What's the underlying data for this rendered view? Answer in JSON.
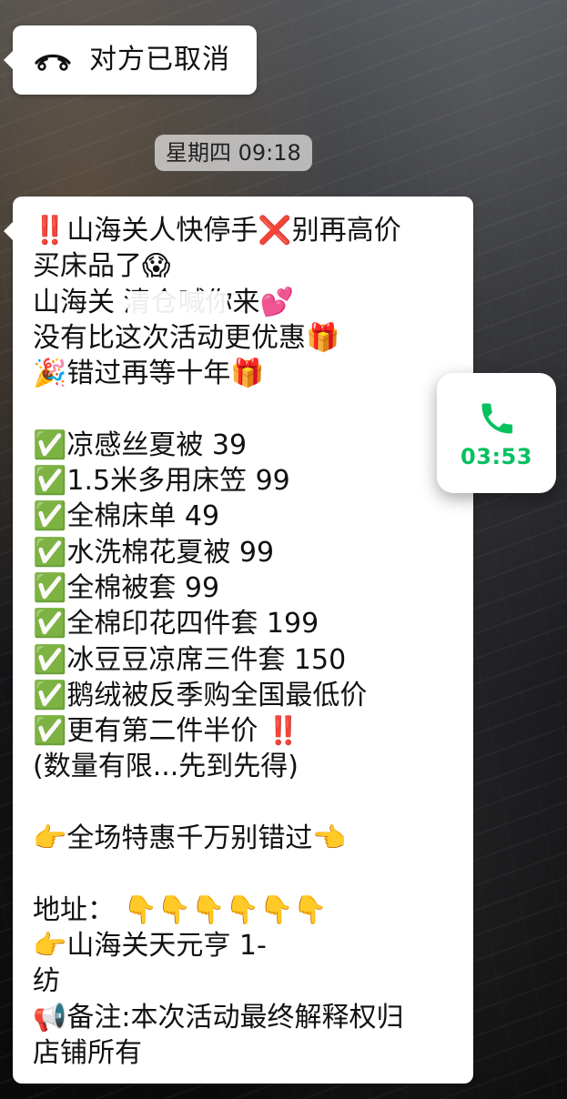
{
  "chat": {
    "canceled_call": {
      "label": "对方已取消",
      "icon": "hangup-phone-icon"
    },
    "timestamp": "星期四 09:18",
    "message": {
      "text": "‼️山海关人快停手❌别再高价\n买床品了😱\n山海关 清仓喊你来💕\n 没有比这次活动更优惠🎁\n    🎉错过再等十年🎁\n\n✅凉感丝夏被 39\n✅1.5米多用床笠 99\n✅全棉床单 49\n✅水洗棉花夏被 99\n✅全棉被套 99\n✅全棉印花四件套 199\n✅冰豆豆凉席三件套 150\n✅鹅绒被反季购全国最低价\n✅更有第二件半价 ‼️\n(数量有限...先到先得)\n\n👉全场特惠千万别错过👈\n\n地址： 👇👇👇👇👇👇\n👉山海关天元亨 1-\n纺\n📢备注:本次活动最终解释权归\n店铺所有"
    }
  },
  "floating_call": {
    "duration": "03:53",
    "icon": "phone-icon",
    "accent": "#07c160"
  },
  "colors": {
    "bubble_bg": "#ffffff",
    "timestamp_bg": "rgba(255,255,255,0.62)",
    "text": "#111111"
  }
}
